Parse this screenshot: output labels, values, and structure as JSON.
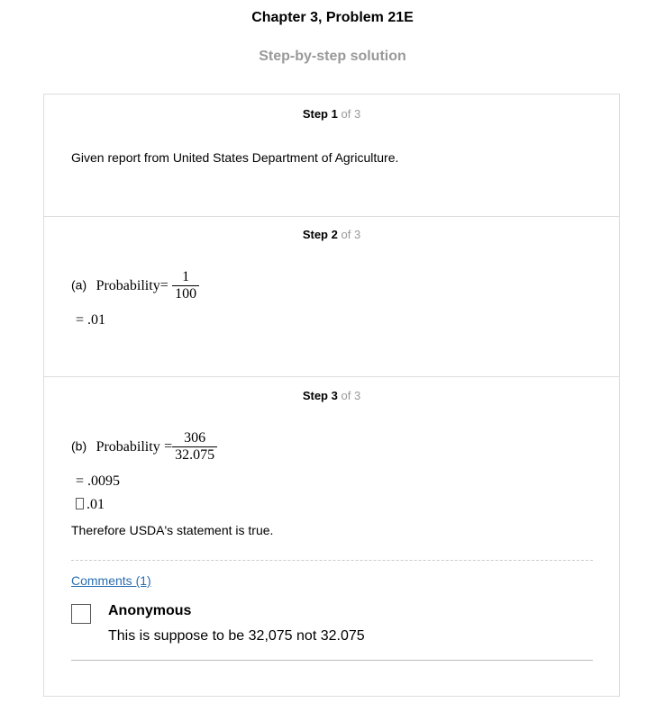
{
  "header": {
    "title": "Chapter 3, Problem 21E",
    "subtitle": "Step-by-step solution"
  },
  "steps": [
    {
      "label": "Step",
      "number": "1",
      "of": "of 3",
      "text": "Given report from United States Department of Agriculture."
    },
    {
      "label": "Step",
      "number": "2",
      "of": "of 3",
      "part": "(a)",
      "lhs": "Probability",
      "eq": "=",
      "numerator": "1",
      "denominator": "100",
      "result": "= .01"
    },
    {
      "label": "Step",
      "number": "3",
      "of": "of 3",
      "part": "(b)",
      "lhs": "Probability",
      "eq": "=",
      "numerator": "306",
      "denominator": "32.075",
      "result": "= .0095",
      "approx": ".01",
      "conclusion": "Therefore USDA's statement is true."
    }
  ],
  "comments": {
    "link": "Comments (1)",
    "items": [
      {
        "author": "Anonymous",
        "text": "This is suppose to be 32,075 not 32.075"
      }
    ]
  }
}
